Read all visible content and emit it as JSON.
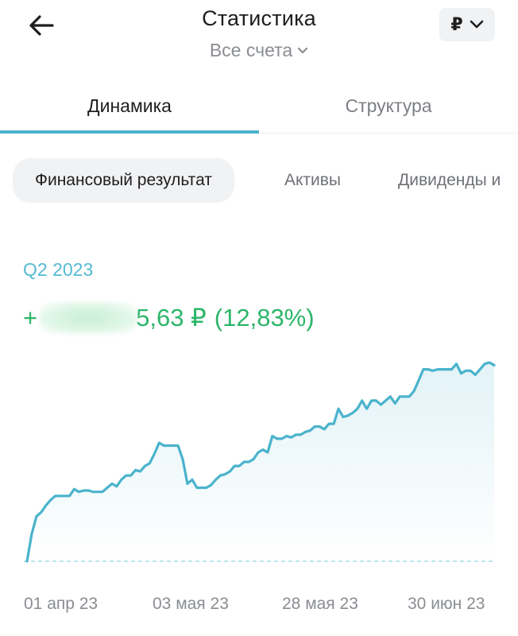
{
  "header": {
    "back_icon": "arrow-left-icon",
    "title": "Статистика",
    "account_selector": "Все счета",
    "account_selector_icon": "chevron-down-icon",
    "currency": "₽",
    "currency_icon": "chevron-down-icon"
  },
  "main_tabs": [
    {
      "label": "Динамика",
      "active": true
    },
    {
      "label": "Структура",
      "active": false
    }
  ],
  "chips": [
    {
      "label": "Финансовый результат",
      "active": true
    },
    {
      "label": "Активы",
      "active": false
    },
    {
      "label": "Дивиденды и",
      "active": false
    }
  ],
  "summary": {
    "period": "Q2 2023",
    "sign": "+",
    "amount_visible_part": "5,63 ₽",
    "percent": "(12,83%)"
  },
  "colors": {
    "accent": "#4ab3cc",
    "line": "#4ab3cc",
    "positive": "#2db56a",
    "period": "#54bad3"
  },
  "chart_data": {
    "type": "area",
    "x_tick_labels": [
      "01 апр 23",
      "03 мая 23",
      "28 мая 23",
      "30 июн 23"
    ],
    "values": [
      0,
      20,
      33,
      36,
      41,
      45,
      48,
      48,
      48,
      48,
      53,
      51,
      52,
      52,
      51,
      51,
      51,
      54,
      57,
      55,
      60,
      63,
      63,
      67,
      66,
      70,
      72,
      79,
      87,
      85,
      85,
      85,
      85,
      75,
      57,
      60,
      54,
      54,
      54,
      56,
      60,
      63,
      64,
      66,
      70,
      70,
      73,
      73,
      75,
      80,
      82,
      80,
      92,
      90,
      90,
      92,
      91,
      93,
      93,
      95,
      96,
      99,
      99,
      97,
      101,
      101,
      112,
      106,
      107,
      109,
      112,
      118,
      112,
      118,
      118,
      115,
      118,
      121,
      116,
      121,
      121,
      121,
      125,
      133,
      141,
      141,
      140,
      141,
      141,
      141,
      141,
      145,
      138,
      140,
      140,
      137,
      141,
      145,
      146,
      144
    ],
    "baseline": 0,
    "grid": false,
    "legend": "none"
  }
}
